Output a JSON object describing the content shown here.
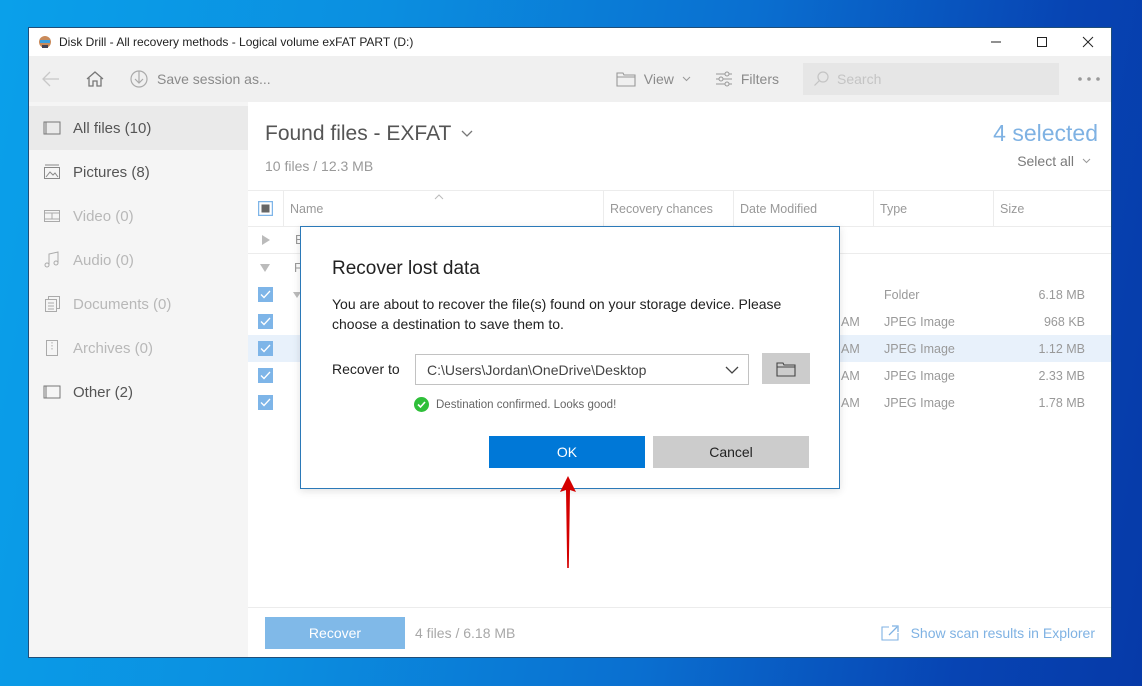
{
  "window": {
    "title": "Disk Drill - All recovery methods - Logical volume exFAT PART (D:)",
    "controls": [
      "minimize",
      "maximize",
      "close"
    ]
  },
  "toolbar": {
    "back_icon": "arrow-left-icon",
    "home_icon": "home-icon",
    "save_session_label": "Save session as...",
    "view_label": "View",
    "filters_label": "Filters",
    "search_placeholder": "Search",
    "more_icon": "ellipsis-icon"
  },
  "sidebar": {
    "items": [
      {
        "label": "All files (10)",
        "icon": "all-files-icon",
        "state": "active"
      },
      {
        "label": "Pictures (8)",
        "icon": "picture-icon",
        "state": "enabled"
      },
      {
        "label": "Video (0)",
        "icon": "video-icon",
        "state": "disabled"
      },
      {
        "label": "Audio (0)",
        "icon": "music-icon",
        "state": "disabled"
      },
      {
        "label": "Documents (0)",
        "icon": "document-icon",
        "state": "disabled"
      },
      {
        "label": "Archives (0)",
        "icon": "archive-icon",
        "state": "disabled"
      },
      {
        "label": "Other (2)",
        "icon": "other-icon",
        "state": "enabled"
      }
    ]
  },
  "main": {
    "title": "Found files - EXFAT",
    "subtitle": "10 files / 12.3 MB",
    "selected_count": "4 selected",
    "select_all_label": "Select all",
    "columns": [
      "Name",
      "Recovery chances",
      "Date Modified",
      "Type",
      "Size"
    ],
    "group_rows": [
      {
        "initial": "E",
        "expanded": false
      },
      {
        "initial": "F",
        "expanded": true
      }
    ],
    "rows": [
      {
        "checked": true,
        "date_suffix": "",
        "type": "Folder",
        "size": "6.18 MB",
        "highlight": false
      },
      {
        "checked": true,
        "date_suffix": "AM",
        "type": "JPEG Image",
        "size": "968 KB",
        "highlight": false
      },
      {
        "checked": true,
        "date_suffix": "AM",
        "type": "JPEG Image",
        "size": "1.12 MB",
        "highlight": true
      },
      {
        "checked": true,
        "date_suffix": "AM",
        "type": "JPEG Image",
        "size": "2.33 MB",
        "highlight": false
      },
      {
        "checked": true,
        "date_suffix": "AM",
        "type": "JPEG Image",
        "size": "1.78 MB",
        "highlight": false
      }
    ]
  },
  "bottom": {
    "recover_label": "Recover",
    "summary": "4 files / 6.18 MB",
    "explorer_link": "Show scan results in Explorer"
  },
  "dialog": {
    "title": "Recover lost data",
    "message": "You are about to recover the file(s) found on your storage device. Please choose a destination to save them to.",
    "recover_to_label": "Recover to",
    "destination": "C:\\Users\\Jordan\\OneDrive\\Desktop",
    "confirm_note": "Destination confirmed. Looks good!",
    "ok_label": "OK",
    "cancel_label": "Cancel"
  },
  "colors": {
    "accent": "#0078d7",
    "selected_text": "#7fb2e3",
    "checkbox": "#7eb5e8",
    "success": "#2fbf3a",
    "annotation_arrow": "#d40000"
  }
}
